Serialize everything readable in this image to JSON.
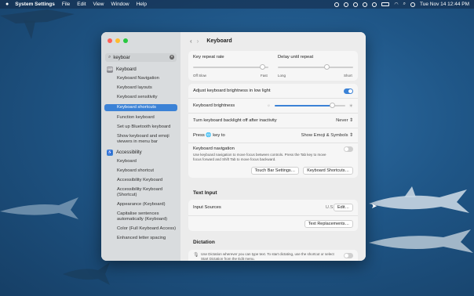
{
  "menubar": {
    "app_name": "System Settings",
    "items": [
      "File",
      "Edit",
      "View",
      "Window",
      "Help"
    ],
    "clock": "Tue Nov 14  12:44 PM"
  },
  "window": {
    "title": "Keyboard",
    "search": {
      "value": "keyboar"
    },
    "sidebar": {
      "keyboard_group": "Keyboard",
      "keyboard_items": [
        "Keyboard Navigation",
        "Keyboard layouts",
        "Keyboard sensitivity",
        "Keyboard shortcuts",
        "Function keyboard",
        "Set up Bluetooth keyboard",
        "Show keyboard and emoji viewers in menu bar"
      ],
      "selected_index": 3,
      "accessibility_group": "Accessibility",
      "accessibility_items": [
        "Keyboard",
        "Keyboard shortcut",
        "Accessibility Keyboard",
        "Accessibility Keyboard (Shortcut)",
        "Appearance (Keyboard)",
        "Capitalise sentences automatically (Keyboard)",
        "Color (Full Keyboard Access)",
        "Enhanced letter spacing"
      ]
    },
    "repeat": {
      "key_repeat_label": "Key repeat rate",
      "delay_label": "Delay until repeat",
      "key_repeat_left": "Off  Slow",
      "key_repeat_right": "Fast",
      "delay_left": "Long",
      "delay_right": "Short",
      "key_repeat_level": 0.92,
      "delay_level": 0.65
    },
    "settings": {
      "adjust_brightness": "Adjust keyboard brightness in low light",
      "brightness_label": "Keyboard brightness",
      "brightness_level": 0.82,
      "backlight_label": "Turn keyboard backlight off after inactivity",
      "backlight_value": "Never",
      "press_key_label": "Press 🌐 key to",
      "press_key_value": "Show Emoji & Symbols",
      "nav_label": "Keyboard navigation",
      "nav_desc": "Use keyboard navigation to move focus between controls. Press the Tab key to move focus forward and Shift Tab to move focus backward.",
      "touch_bar_button": "Touch Bar Settings…",
      "shortcuts_button": "Keyboard Shortcuts…"
    },
    "text_input": {
      "section": "Text Input",
      "input_sources_label": "Input Sources",
      "input_sources_value": "U.S.",
      "edit_button": "Edit…",
      "replacements_button": "Text Replacements…"
    },
    "dictation": {
      "section": "Dictation",
      "desc": "Use Dictation wherever you can type text. To start dictating, use the shortcut or select Start Dictation from the Edit menu."
    }
  },
  "colors": {
    "accent": "#3b82d6",
    "wallpaper": "#1f5687"
  }
}
